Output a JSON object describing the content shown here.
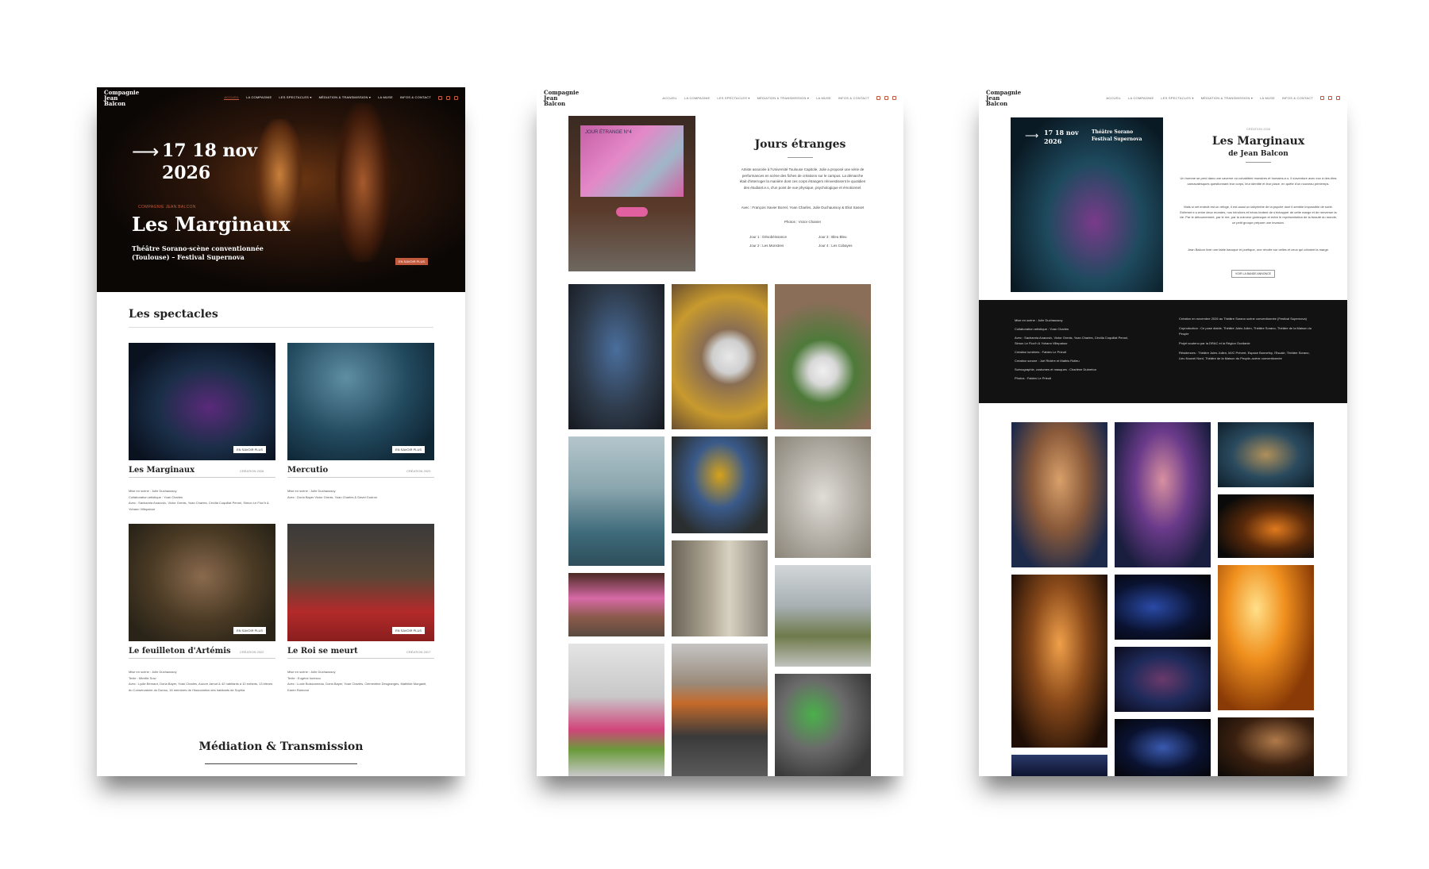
{
  "mockup_1": {
    "logo": "Compagnie Jean Balcon",
    "nav": [
      "ACCUEIL",
      "LA COMPAGNIE",
      "LES SPECTACLES ▾",
      "MÉDIATION & TRANSMISSION ▾",
      "LA MUSE",
      "INFOS & CONTACT"
    ],
    "hero": {
      "arrow": "⟶",
      "date": "17 18 nov 2026",
      "kicker": "COMPAGNIE JEAN BALCON",
      "title": "Les Marginaux",
      "venue": "Théâtre Sorano·scène conventionnée (Toulouse) – Festival Supernova",
      "cta": "EN SAVOIR PLUS"
    },
    "section_title": "Les spectacles",
    "cards": [
      {
        "title": "Les Marginaux",
        "year": "CRÉATION 2026",
        "button": "EN SAVOIR PLUS",
        "credits": "Mise en scène : Julie Duchaussoy\nCollaboration artistique : Yoan Charles\nAvec : Sacharnia Anacovic, Victor Grenis, Yoan Charles, Cécilia Coquillat Peroni, Simon Le Floc'h & Yohann Villepatour"
      },
      {
        "title": "Mercutio",
        "year": "CRÉATION 2023",
        "button": "EN SAVOIR PLUS",
        "credits": "Mise en scène : Julie Duchaussoy\nAvec : Doria Bayer Victor Grenis, Yoan Charles & David Gudron"
      },
      {
        "title": "Le feuilleton d'Artémis",
        "year": "CRÉATION 2022",
        "button": "EN SAVOIR PLUS",
        "credits": "Mise en scène : Julie Duchaussoy\nTexte : Mireille Sow\nAvec : Lydie Bernard, Doria Bayer, Yoan Charles, Aurore Jamot & 42 habitants à 10 enfants, 13 élèves du Conservatoire du Donau, 16 membres de l'Association des habitants de Sophia"
      },
      {
        "title": "Le Roi se meurt",
        "year": "CRÉATION 2017",
        "button": "EN SAVOIR PLUS",
        "credits": "Mise en scène : Julie Duchaussoy\nTexte : Eugène Ionesco\nAvec : Lucie Boissonneau, Doria Bayer, Yoan Charles, Clémentine Desgranges, Mathilde Morganti, Karen Ramond"
      }
    ],
    "footer_title": "Médiation & Transmission"
  },
  "mockup_2": {
    "logo": "Compagnie Jean Balcon",
    "nav": [
      "ACCUEIL",
      "LA COMPAGNIE",
      "LES SPECTACLES ▾",
      "MÉDIATION & TRANSMISSION ▾",
      "LA MUSE",
      "INFOS & CONTACT"
    ],
    "screen_text": "JOUR ÉTRANGE N°4",
    "title": "Jours étranges",
    "intro": "Artiste associée à l'Université Toulouse Capitole, Julie a proposé une série de performances en scène des fiches de créations sur le campus. La démarche était d'interroger la manière dont ces corps étrangers réinvestissent le quotidien des étudiant.e.s, d'un point de vue physique, psychologique et émotionnel.",
    "cast": "Avec : François Xavier Borrel, Yoan Charles, Julie Duchaussoy & Eliot Sasset",
    "photos": "Photos : Victor Chanier",
    "days": [
      "Jour 1 : Désobéissance",
      "Jour 3 : Bleu Bleu",
      "Jour 2 : Les Monstres",
      "Jour 4 : Les Cobayes"
    ]
  },
  "mockup_3": {
    "logo": "Compagnie Jean Balcon",
    "nav": [
      "ACCUEIL",
      "LA COMPAGNIE",
      "LES SPECTACLES ▾",
      "MÉDIATION & TRANSMISSION ▾",
      "LA MUSE",
      "INFOS & CONTACT"
    ],
    "poster": {
      "arrow": "⟶",
      "date": "17 18 nov 2026",
      "venue": "Théâtre Sorano Festival Supernova"
    },
    "kicker": "CRÉATION 2026",
    "title": "Les Marginaux",
    "subtitle": "de Jean Balcon",
    "para1": "Un homme se perd dans une caverne où cohabitent monstres et humains.e.s. Il s'aventure avec eux à des rites carnavalesques questionnant leur corps, leur identité et leur place, en quête d'un nouveau printemps.",
    "para2": "Mais si cet endroit est un refuge, il est aussi un labyrinthe de la psyché dont il semble impossible de sortir. Enfermé.e.s entre deux mondes, nos héroïnes et héros tentent de s'échapper de cette marge et de renverser la vie. Par le détournement, par le rire, par la noirceur grotesque et entre le représentation de la beauté du monde, ce petit groupe prépare une invasion.",
    "para3": "Jean Balcon livre une fable baroque et poétique, une révolte sur celles et ceux qui côtoient la marge.",
    "button": "VOIR LA BANDE ANNONCE",
    "credits_left": [
      "Mise en scène : Julie Duchaussoy",
      "Collaboration artistique : Yoan Charles",
      "Avec : Sacharnia Anacovic, Victor Grenis, Yoan Charles, Cécilia Coquillat Peroni, Simon Le Floc'h & Yohann Villepatour",
      "Création lumières : Fabien Le Prieult",
      "Création sonore : Joé Rivière et Mathis Rolleu",
      "Scénographie, costumes et masques : Charlène Dubreton",
      "Photos : Fabien Le Prieult"
    ],
    "credits_right": [
      "Création en novembre 2026 au Théâtre Sorano scène conventionnée (Festival Supernova)",
      "Coproduction : Ce pose diable, Théâtre Jules Julien, Théâtre Sorano, Théâtre de la Maison du Peuple",
      "Projet soutenu par la DRAC et la Région Occitanie",
      "Résidences : Théâtre Jules Julien, MJC Prévert, Espace Bonnefoy, l'Escale, Théâtre Sorano, Lieu Nouvel Nord, Théâtre de la Maison du Peuple–scène conventionnée"
    ]
  },
  "colors": {
    "accent": "#c25a3d",
    "dark": "#121212"
  }
}
